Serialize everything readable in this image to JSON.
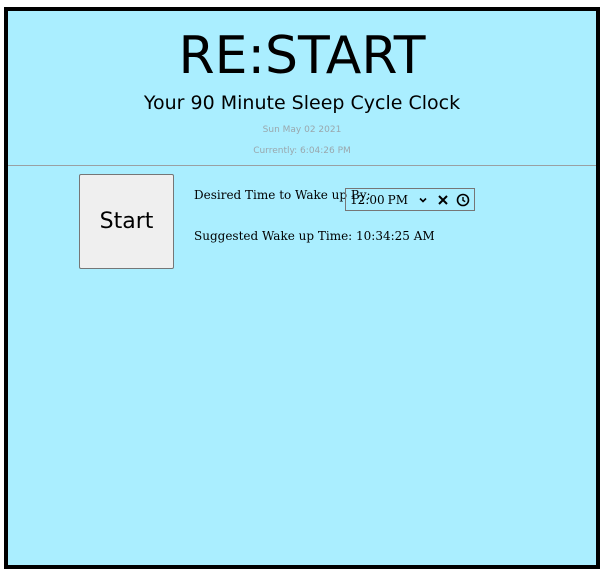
{
  "header": {
    "title": "RE:START",
    "subtitle": "Your 90 Minute Sleep Cycle Clock",
    "date": "Sun May 02 2021",
    "current_time": "Currently: 6:04:26 PM"
  },
  "controls": {
    "start_label": "Start",
    "desired_label": "Desired Time to Wake up By:",
    "time_input": {
      "hour": "12",
      "separator": ":",
      "minute": "00",
      "ampm": "PM"
    },
    "suggested_text": "Suggested Wake up Time: 10:34:25 AM"
  },
  "icons": {
    "dropdown": "chevron-down-icon",
    "clear": "close-icon",
    "clock": "clock-icon"
  }
}
